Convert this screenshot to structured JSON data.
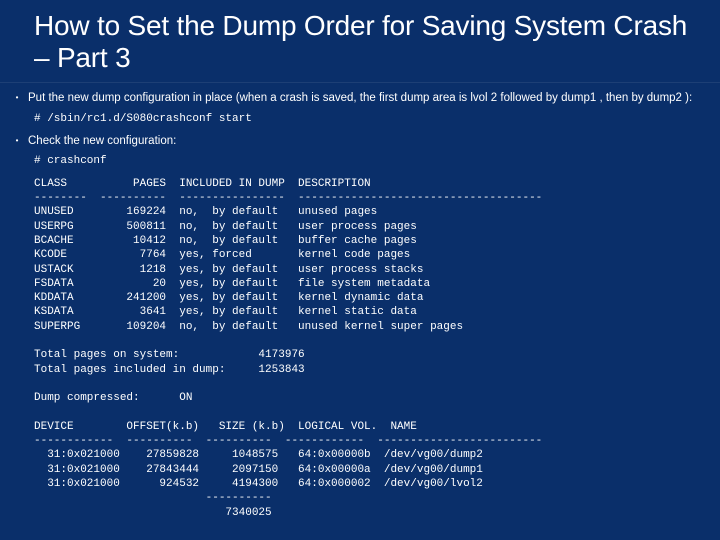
{
  "title": "How to Set the Dump Order for Saving System Crash – Part 3",
  "b1": {
    "text": "Put the new dump configuration in place (when a crash is saved, the first dump area is lvol 2 followed by dump1 , then by dump2 ):",
    "cmd": "# /sbin/rc1.d/S080crashconf start"
  },
  "b2": {
    "text": "Check the new configuration:",
    "cmd": "# crashconf"
  },
  "classes": {
    "header": "CLASS          PAGES  INCLUDED IN DUMP  DESCRIPTION",
    "divider": "--------  ----------  ----------------  -------------------------------------",
    "r0": "UNUSED        169224  no,  by default   unused pages",
    "r1": "USERPG        500811  no,  by default   user process pages",
    "r2": "BCACHE         10412  no,  by default   buffer cache pages",
    "r3": "KCODE           7764  yes, forced       kernel code pages",
    "r4": "USTACK          1218  yes, by default   user process stacks",
    "r5": "FSDATA            20  yes, by default   file system metadata",
    "r6": "KDDATA        241200  yes, by default   kernel dynamic data",
    "r7": "KSDATA          3641  yes, by default   kernel static data",
    "r8": "SUPERPG       109204  no,  by default   unused kernel super pages"
  },
  "totals": {
    "t0": "Total pages on system:            4173976",
    "t1": "Total pages included in dump:     1253843"
  },
  "compressed": "Dump compressed:      ON",
  "devices": {
    "header": "DEVICE        OFFSET(k.b)   SIZE (k.b)  LOGICAL VOL.  NAME",
    "divider": "------------  ----------  ----------  ------------  -------------------------",
    "r0": "  31:0x021000    27859828     1048575   64:0x00000b  /dev/vg00/dump2",
    "r1": "  31:0x021000    27843444     2097150   64:0x00000a  /dev/vg00/dump1",
    "r2": "  31:0x021000      924532     4194300   64:0x000002  /dev/vg00/lvol2",
    "sumdiv": "                          ----------",
    "sum": "                             7340025"
  }
}
